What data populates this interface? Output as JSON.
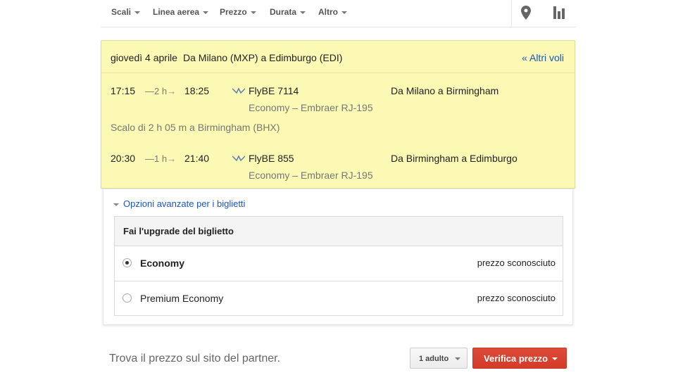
{
  "filters": [
    {
      "label": "Scali"
    },
    {
      "label": "Linea aerea"
    },
    {
      "label": "Prezzo"
    },
    {
      "label": "Durata"
    },
    {
      "label": "Altro"
    }
  ],
  "icons": {
    "map": "map-pin-icon",
    "chart": "bar-chart-icon"
  },
  "itinerary": {
    "date": "giovedì 4 aprile",
    "route": "Da Milano (MXP) a Edimburgo (EDI)",
    "more_link": "« Altri voli",
    "segments": [
      {
        "departure": "17:15",
        "duration": "2 h",
        "arrival": "18:25",
        "airline_flight": "FlyBE 7114",
        "class_aircraft": "Economy – Embraer RJ-195",
        "route": "Da Milano a Birmingham"
      },
      {
        "departure": "20:30",
        "duration": "1 h",
        "arrival": "21:40",
        "airline_flight": "FlyBE 855",
        "class_aircraft": "Economy – Embraer RJ-195",
        "route": "Da Birmingham a Edimburgo"
      }
    ],
    "layover": "Scalo di 2 h 05 m a Birmingham (BHX)"
  },
  "options": {
    "advanced_link": "Opzioni avanzate per i biglietti",
    "upgrade_header": "Fai l'upgrade del biglietto",
    "classes": [
      {
        "name": "Economy",
        "price": "prezzo sconosciuto",
        "selected": true
      },
      {
        "name": "Premium Economy",
        "price": "prezzo sconosciuto",
        "selected": false
      }
    ]
  },
  "footer": {
    "partner_text": "Trova il prezzo sul sito del partner.",
    "passengers": "1 adulto",
    "verify_label": "Verifica prezzo"
  },
  "colors": {
    "itinerary_bg": "#fbf9b4",
    "link": "#1a55c8",
    "verify_button": "#dd4b39"
  }
}
